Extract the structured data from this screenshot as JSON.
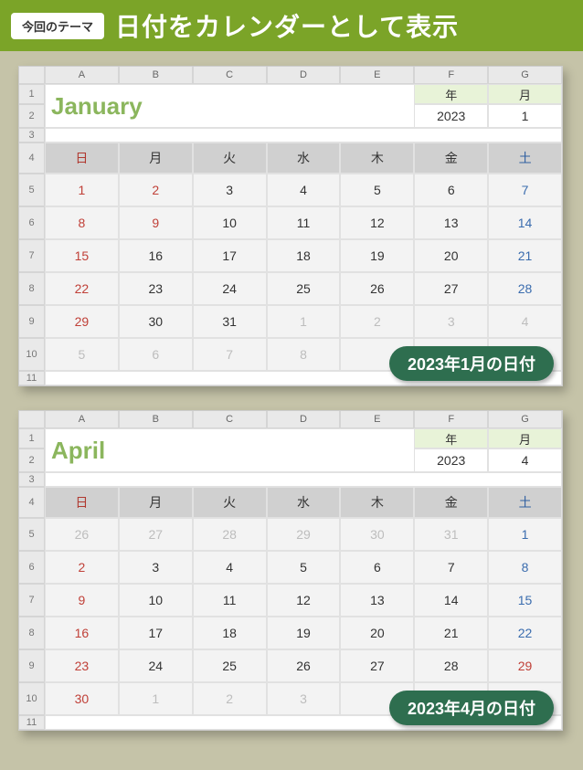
{
  "header": {
    "badge": "今回のテーマ",
    "title": "日付をカレンダーとして表示"
  },
  "columns": [
    "A",
    "B",
    "C",
    "D",
    "E",
    "F",
    "G"
  ],
  "row_labels": [
    "1",
    "2",
    "3",
    "4",
    "5",
    "6",
    "7",
    "8",
    "9",
    "10",
    "11"
  ],
  "dow": [
    "日",
    "月",
    "火",
    "水",
    "木",
    "金",
    "土"
  ],
  "ym_labels": {
    "year": "年",
    "month": "月"
  },
  "sheets": [
    {
      "month_title": "January",
      "year": "2023",
      "month": "1",
      "caption": "2023年1月の日付",
      "weeks": [
        [
          {
            "v": "1",
            "c": "sun"
          },
          {
            "v": "2",
            "c": "sun"
          },
          {
            "v": "3",
            "c": ""
          },
          {
            "v": "4",
            "c": ""
          },
          {
            "v": "5",
            "c": ""
          },
          {
            "v": "6",
            "c": ""
          },
          {
            "v": "7",
            "c": "sat"
          }
        ],
        [
          {
            "v": "8",
            "c": "sun"
          },
          {
            "v": "9",
            "c": "sun"
          },
          {
            "v": "10",
            "c": ""
          },
          {
            "v": "11",
            "c": ""
          },
          {
            "v": "12",
            "c": ""
          },
          {
            "v": "13",
            "c": ""
          },
          {
            "v": "14",
            "c": "sat"
          }
        ],
        [
          {
            "v": "15",
            "c": "sun"
          },
          {
            "v": "16",
            "c": ""
          },
          {
            "v": "17",
            "c": ""
          },
          {
            "v": "18",
            "c": ""
          },
          {
            "v": "19",
            "c": ""
          },
          {
            "v": "20",
            "c": ""
          },
          {
            "v": "21",
            "c": "sat"
          }
        ],
        [
          {
            "v": "22",
            "c": "sun"
          },
          {
            "v": "23",
            "c": ""
          },
          {
            "v": "24",
            "c": ""
          },
          {
            "v": "25",
            "c": ""
          },
          {
            "v": "26",
            "c": ""
          },
          {
            "v": "27",
            "c": ""
          },
          {
            "v": "28",
            "c": "sat"
          }
        ],
        [
          {
            "v": "29",
            "c": "sun"
          },
          {
            "v": "30",
            "c": ""
          },
          {
            "v": "31",
            "c": ""
          },
          {
            "v": "1",
            "c": "gray"
          },
          {
            "v": "2",
            "c": "gray"
          },
          {
            "v": "3",
            "c": "gray"
          },
          {
            "v": "4",
            "c": "gray"
          }
        ],
        [
          {
            "v": "5",
            "c": "gray"
          },
          {
            "v": "6",
            "c": "gray"
          },
          {
            "v": "7",
            "c": "gray"
          },
          {
            "v": "8",
            "c": "gray"
          },
          {
            "v": "",
            "c": ""
          },
          {
            "v": "",
            "c": ""
          },
          {
            "v": "",
            "c": ""
          }
        ]
      ]
    },
    {
      "month_title": "April",
      "year": "2023",
      "month": "4",
      "caption": "2023年4月の日付",
      "weeks": [
        [
          {
            "v": "26",
            "c": "gray"
          },
          {
            "v": "27",
            "c": "gray"
          },
          {
            "v": "28",
            "c": "gray"
          },
          {
            "v": "29",
            "c": "gray"
          },
          {
            "v": "30",
            "c": "gray"
          },
          {
            "v": "31",
            "c": "gray"
          },
          {
            "v": "1",
            "c": "sat"
          }
        ],
        [
          {
            "v": "2",
            "c": "sun"
          },
          {
            "v": "3",
            "c": ""
          },
          {
            "v": "4",
            "c": ""
          },
          {
            "v": "5",
            "c": ""
          },
          {
            "v": "6",
            "c": ""
          },
          {
            "v": "7",
            "c": ""
          },
          {
            "v": "8",
            "c": "sat"
          }
        ],
        [
          {
            "v": "9",
            "c": "sun"
          },
          {
            "v": "10",
            "c": ""
          },
          {
            "v": "11",
            "c": ""
          },
          {
            "v": "12",
            "c": ""
          },
          {
            "v": "13",
            "c": ""
          },
          {
            "v": "14",
            "c": ""
          },
          {
            "v": "15",
            "c": "sat"
          }
        ],
        [
          {
            "v": "16",
            "c": "sun"
          },
          {
            "v": "17",
            "c": ""
          },
          {
            "v": "18",
            "c": ""
          },
          {
            "v": "19",
            "c": ""
          },
          {
            "v": "20",
            "c": ""
          },
          {
            "v": "21",
            "c": ""
          },
          {
            "v": "22",
            "c": "sat"
          }
        ],
        [
          {
            "v": "23",
            "c": "sun"
          },
          {
            "v": "24",
            "c": ""
          },
          {
            "v": "25",
            "c": ""
          },
          {
            "v": "26",
            "c": ""
          },
          {
            "v": "27",
            "c": ""
          },
          {
            "v": "28",
            "c": ""
          },
          {
            "v": "29",
            "c": "sun"
          }
        ],
        [
          {
            "v": "30",
            "c": "sun"
          },
          {
            "v": "1",
            "c": "gray"
          },
          {
            "v": "2",
            "c": "gray"
          },
          {
            "v": "3",
            "c": "gray"
          },
          {
            "v": "",
            "c": ""
          },
          {
            "v": "",
            "c": ""
          },
          {
            "v": "",
            "c": ""
          }
        ]
      ]
    }
  ]
}
